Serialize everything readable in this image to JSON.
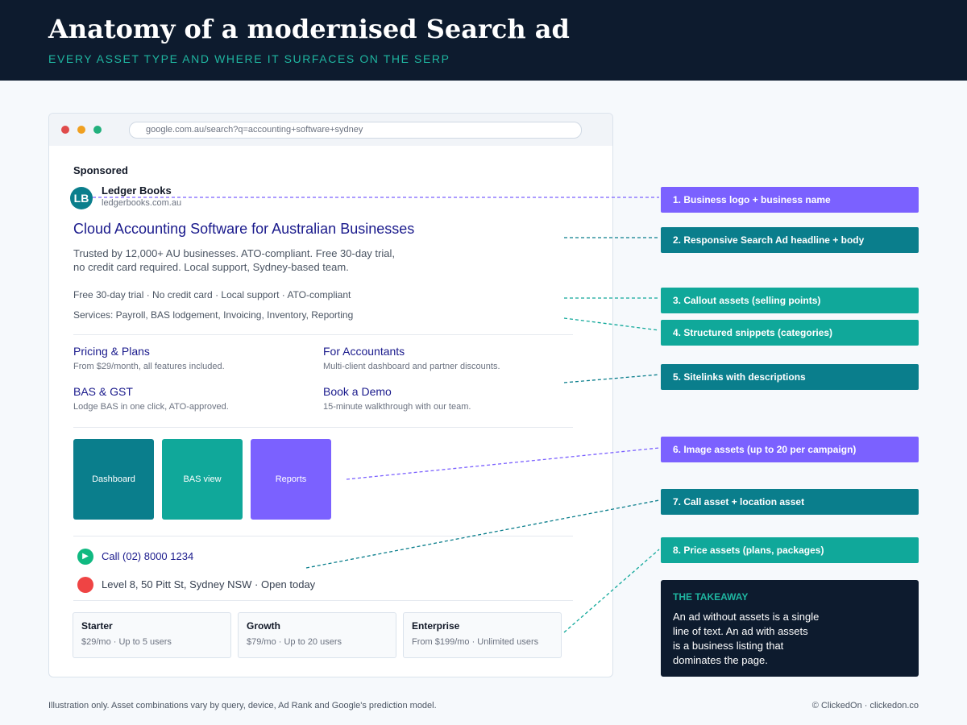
{
  "header": {
    "title": "Anatomy of a modernised Search ad",
    "subtitle": "EVERY ASSET TYPE AND WHERE IT SURFACES ON THE SERP"
  },
  "browser": {
    "url": "google.com.au/search?q=accounting+software+sydney",
    "window_dot_colors": [
      "#e04b4b",
      "#f0a020",
      "#22b07d"
    ]
  },
  "ad": {
    "sponsored": "Sponsored",
    "logo_text": "LB",
    "business_name": "Ledger Books",
    "domain": "ledgerbooks.com.au",
    "headline": "Cloud Accounting Software for Australian Businesses",
    "body_line1": "Trusted by 12,000+ AU businesses. ATO-compliant. Free 30-day trial,",
    "body_line2": "no credit card required. Local support, Sydney-based team.",
    "callouts": "Free 30-day trial · No credit card · Local support · ATO-compliant",
    "snippets": "Services: Payroll, BAS lodgement, Invoicing, Inventory, Reporting",
    "sitelinks": [
      {
        "title": "Pricing & Plans",
        "desc": "From $29/month, all features included."
      },
      {
        "title": "For Accountants",
        "desc": "Multi-client dashboard and partner discounts."
      },
      {
        "title": "BAS & GST",
        "desc": "Lodge BAS in one click, ATO-approved."
      },
      {
        "title": "Book a Demo",
        "desc": "15-minute walkthrough with our team."
      }
    ],
    "images": [
      {
        "label": "Dashboard",
        "color": "#0a7e8c"
      },
      {
        "label": "BAS view",
        "color": "#10a89a"
      },
      {
        "label": "Reports",
        "color": "#7b61ff"
      }
    ],
    "call_icon": "play-icon",
    "call_text": "Call (02) 8000 1234",
    "location_icon": "location-dot-icon",
    "location_text": "Level 8, 50 Pitt St, Sydney NSW · Open today",
    "prices": [
      {
        "name": "Starter",
        "desc": "$29/mo · Up to 5 users"
      },
      {
        "name": "Growth",
        "desc": "$79/mo · Up to 20 users"
      },
      {
        "name": "Enterprise",
        "desc": "From $199/mo · Unlimited users"
      }
    ]
  },
  "labels": [
    {
      "text": "1. Business logo + business name",
      "color": "#7b61ff"
    },
    {
      "text": "2. Responsive Search Ad headline + body",
      "color": "#0a7e8c"
    },
    {
      "text": "3. Callout assets (selling points)",
      "color": "#10a89a"
    },
    {
      "text": "4. Structured snippets (categories)",
      "color": "#10a89a"
    },
    {
      "text": "5. Sitelinks with descriptions",
      "color": "#0a7e8c"
    },
    {
      "text": "6. Image assets (up to 20 per campaign)",
      "color": "#7b61ff"
    },
    {
      "text": "7. Call asset + location asset",
      "color": "#0a7e8c"
    },
    {
      "text": "8. Price assets (plans, packages)",
      "color": "#10a89a"
    }
  ],
  "takeaway": {
    "title": "THE TAKEAWAY",
    "lines": [
      "An ad without assets is a single",
      "line of text. An ad with assets",
      "is a business listing that",
      "dominates the page."
    ]
  },
  "footer": {
    "left": "Illustration only. Asset combinations vary by query, device, Ad Rank and Google's prediction model.",
    "right": "© ClickedOn · clickedon.co"
  }
}
